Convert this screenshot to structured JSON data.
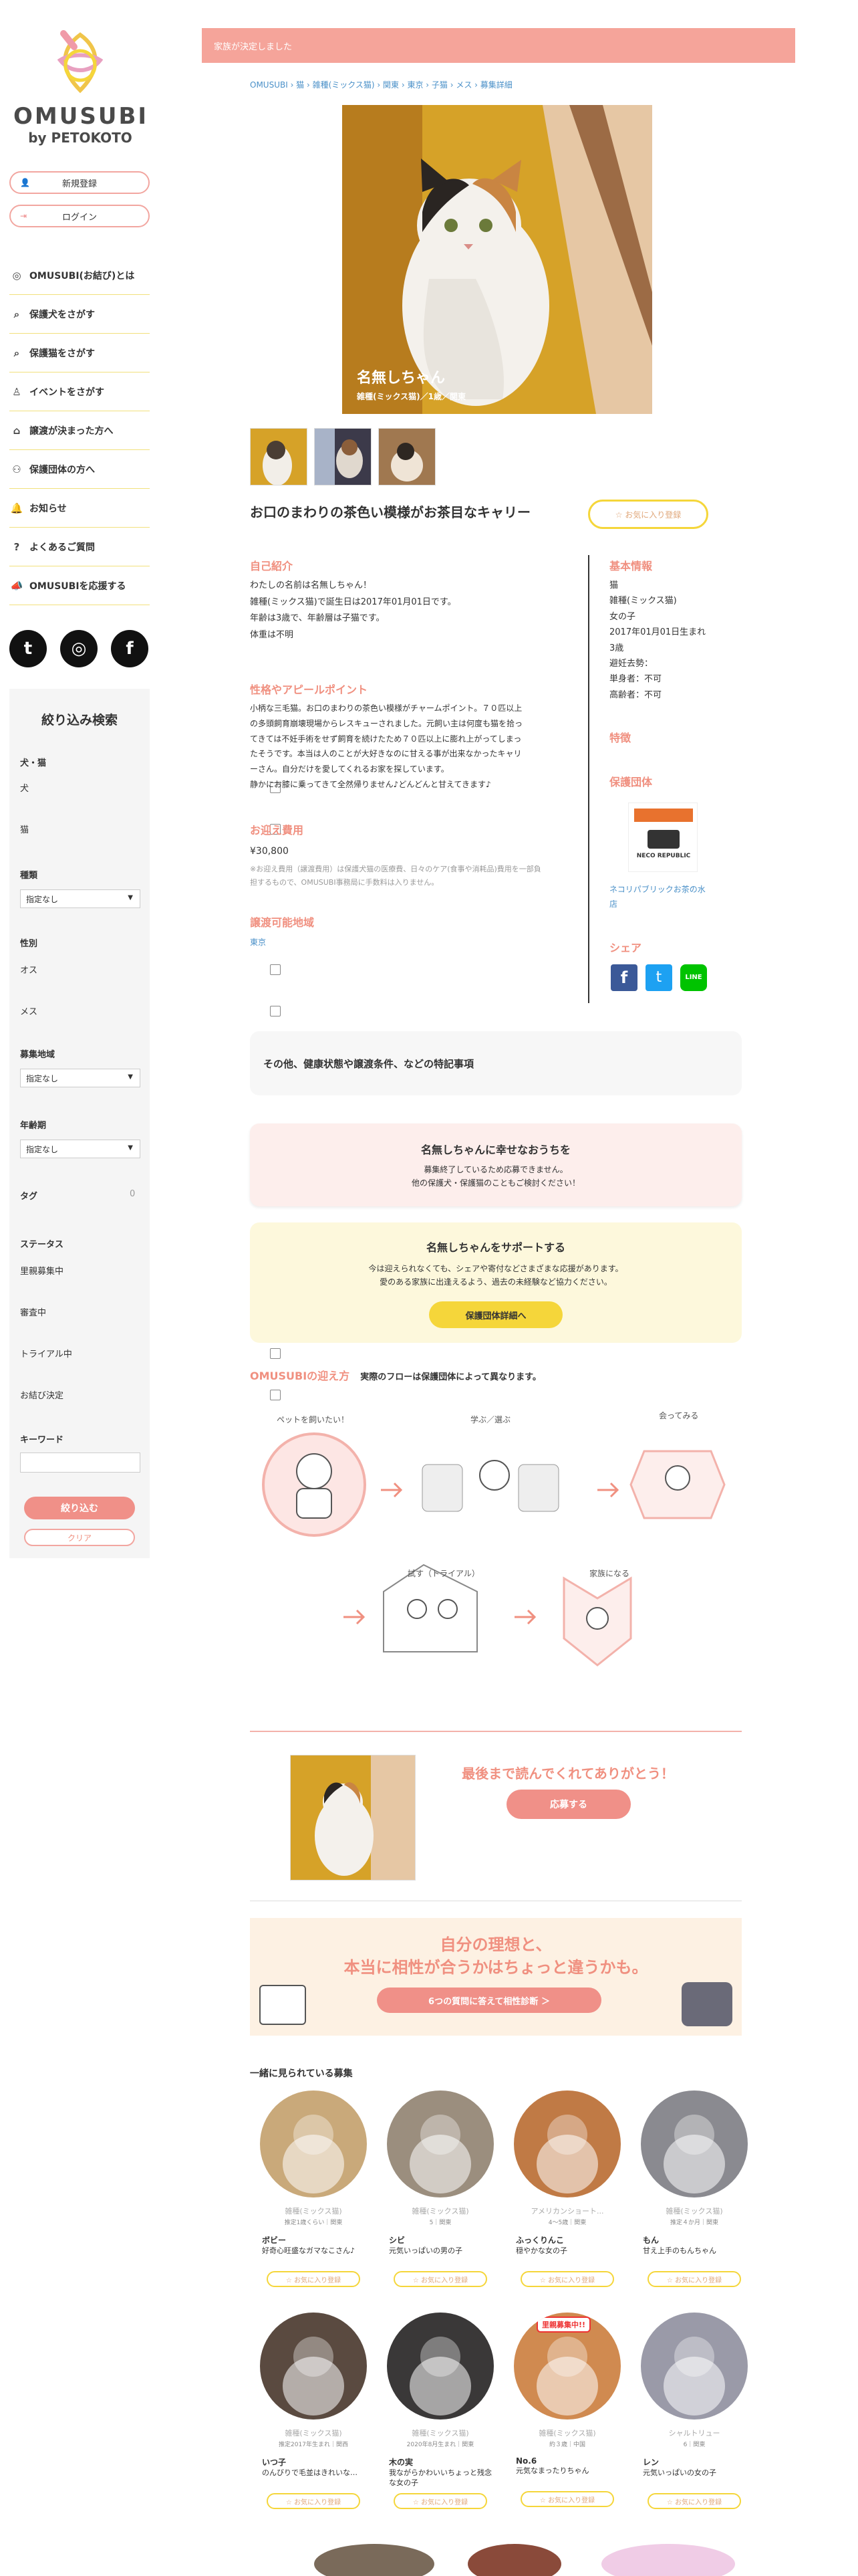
{
  "brand": {
    "name": "OMUSUBI",
    "by": "by PETOKOTO"
  },
  "auth": {
    "signup": "新規登録",
    "login": "ログイン"
  },
  "nav": [
    {
      "label": "OMUSUBI(お結び)とは",
      "icon": "omusubi-icon"
    },
    {
      "label": "保護犬をさがす",
      "icon": "search-icon"
    },
    {
      "label": "保護猫をさがす",
      "icon": "search-icon"
    },
    {
      "label": "イベントをさがす",
      "icon": "event-icon"
    },
    {
      "label": "譲渡が決まった方へ",
      "icon": "house-icon"
    },
    {
      "label": "保護団体の方へ",
      "icon": "people-icon"
    },
    {
      "label": "お知らせ",
      "icon": "bell-icon"
    },
    {
      "label": "よくあるご質問",
      "icon": "question-icon"
    },
    {
      "label": "OMUSUBIを応援する",
      "icon": "megaphone-icon"
    }
  ],
  "social": [
    "twitter-icon",
    "instagram-icon",
    "facebook-icon"
  ],
  "filter": {
    "title": "絞り込み検索",
    "species_label": "犬・猫",
    "species": [
      "犬",
      "猫"
    ],
    "breed_label": "種類",
    "breed_value": "指定なし",
    "sex_label": "性別",
    "sexes": [
      "オス",
      "メス"
    ],
    "area_label": "募集地域",
    "area_value": "指定なし",
    "age_label": "年齢期",
    "age_value": "指定なし",
    "tag_label": "タグ",
    "tag_count": "0",
    "status_label": "ステータス",
    "statuses": [
      "里親募集中",
      "審査中",
      "トライアル中",
      "お結び決定"
    ],
    "keyword_label": "キーワード",
    "submit": "絞り込む",
    "clear": "クリア"
  },
  "banner": "家族が決定しました",
  "breadcrumb": "OMUSUBI › 猫 › 雑種(ミックス猫) › 関東 › 東京 › 子猫 › メス › 募集詳細",
  "pet": {
    "name": "名無しちゃん",
    "sub": "雑種(ミックス猫)／1歳／関東",
    "headline": "お口のまわりの茶色い模様がお茶目なキャリー",
    "fav": "☆ お気に入り登録"
  },
  "intro": {
    "heading": "自己紹介",
    "lines": [
      "わたしの名前は名無しちゃん！",
      "雑種(ミックス猫)で誕生日は2017年01月01日です。",
      "年齢は3歳で、年齢層は子猫です。",
      "体重は不明"
    ]
  },
  "appeal": {
    "heading": "性格やアピールポイント",
    "lines": [
      "小柄な三毛猫。お口のまわりの茶色い模様がチャームポイント。７０匹以上",
      "の多頭飼育崩壊現場からレスキューされました。元飼い主は何度も猫を拾っ",
      "てきては不妊手術をせず飼育を続けたため７０匹以上に膨れ上がってしまっ",
      "たそうです。本当は人のことが大好きなのに甘える事が出来なかったキャリ",
      "ーさん。自分だけを愛してくれるお家を探しています。",
      "静かにお膝に乗ってきて全然帰りません♪どんどんと甘えてきます♪"
    ]
  },
  "fee": {
    "heading": "お迎え費用",
    "amount": "¥30,800",
    "note1": "※お迎え費用（譲渡費用）は保護犬猫の医療費、日々のケア(食事や消耗品)費用を一部負",
    "note2": "担するもので、OMUSUBI事務局に手数料は入りません。"
  },
  "area": {
    "heading": "譲渡可能地域",
    "value": "東京"
  },
  "basic": {
    "heading": "基本情報",
    "lines": [
      "猫",
      "雑種(ミックス猫)",
      "女の子",
      "2017年01月01日生まれ",
      "3歳",
      "避妊去勢：",
      "単身者：不可",
      "高齢者：不可"
    ]
  },
  "feature": {
    "heading": "特徴"
  },
  "org": {
    "heading": "保護団体",
    "logo_text": "NECO REPUBLIC",
    "name1": "ネコリパブリックお茶の水",
    "name2": "店"
  },
  "share": {
    "heading": "シェア"
  },
  "notes_box": "その他、健康状態や譲渡条件、などの特記事項",
  "happy": {
    "title": "名無しちゃんに幸せなおうちを",
    "line1": "募集終了しているため応募できません。",
    "line2": "他の保護犬・保護猫のこともご検討ください！"
  },
  "support": {
    "title": "名無しちゃんをサポートする",
    "line1": "今は迎えられなくても、シェアや寄付などさまざまな応援があります。",
    "line2": "愛のある家族に出逢えるよう、過去の未経験など協力ください。",
    "button": "保護団体詳細へ"
  },
  "flow": {
    "label": "OMUSUBIの迎え方",
    "text": "実際のフローは保護団体によって異なります。",
    "steps": [
      "ペットを飼いたい！",
      "学ぶ／選ぶ",
      "会ってみる",
      "試す（トライアル）",
      "家族になる"
    ]
  },
  "thanks": {
    "title": "最後まで読んでくれてありがとう！",
    "button": "応募する"
  },
  "diag": {
    "line1": "自分の理想と、",
    "line2": "本当に相性が合うかはちょっと違うかも。",
    "button": "6つの質問に答えて相性診断 ＞"
  },
  "related": {
    "heading": "一緒に見られている募集",
    "fav": "☆ お気に入り登録",
    "items": [
      {
        "breed": "雑種(ミックス猫)",
        "meta": "推定1歳くらい｜関東",
        "name": "ボビー",
        "desc": "好奇心旺盛なガマなこさん♪",
        "color": "#c9a97a"
      },
      {
        "breed": "雑種(ミックス猫)",
        "meta": "5｜関東",
        "name": "シビ",
        "desc": "元気いっぱいの男の子",
        "color": "#9b8e7e"
      },
      {
        "breed": "アメリカンショート...",
        "meta": "4～5歳｜関東",
        "name": "ふっくりんこ",
        "desc": "穏やかな女の子",
        "color": "#c07a45"
      },
      {
        "breed": "雑種(ミックス猫)",
        "meta": "推定４か月｜関東",
        "name": "もん",
        "desc": "甘え上手のもんちゃん",
        "color": "#8a8a90"
      },
      {
        "breed": "雑種(ミックス猫)",
        "meta": "推定2017年生まれ｜関西",
        "name": "いつ子",
        "desc": "のんびりで毛並はきれいな…",
        "color": "#5a4a40"
      },
      {
        "breed": "雑種(ミックス猫)",
        "meta": "2020年8月生まれ｜関東",
        "name": "木の実",
        "desc": "我ながらかわいいちょっと残念な女の子",
        "color": "#3a3838"
      },
      {
        "breed": "雑種(ミックス猫)",
        "meta": "約３歳｜中国",
        "name": "No.6",
        "desc": "元気なまったりちゃん",
        "color": "#d08a50",
        "badge": "里親募集中!!"
      },
      {
        "breed": "シャルトリュー",
        "meta": "6｜関東",
        "name": "レン",
        "desc": "元気いっぱいの女の子",
        "color": "#9a9aa8"
      }
    ]
  },
  "colors": {
    "pink": "#f5a49a",
    "yellow": "#f5d63a",
    "accent": "#f09080"
  }
}
